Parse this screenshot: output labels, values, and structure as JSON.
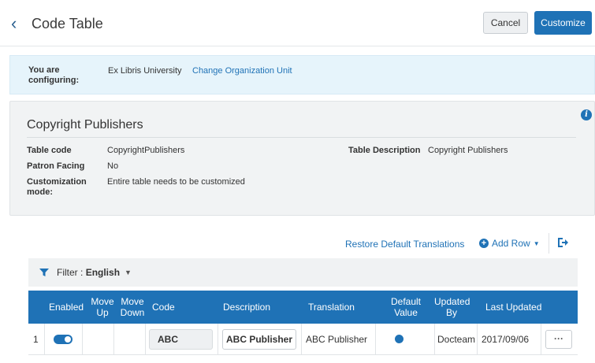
{
  "header": {
    "title": "Code Table",
    "cancel_label": "Cancel",
    "customize_label": "Customize"
  },
  "config": {
    "label": "You are configuring:",
    "org": "Ex Libris University",
    "change_link": "Change Organization Unit"
  },
  "panel": {
    "title": "Copyright Publishers",
    "table_code_label": "Table code",
    "table_code": "CopyrightPublishers",
    "patron_facing_label": "Patron Facing",
    "patron_facing": "No",
    "customization_label": "Customization mode:",
    "customization": "Entire table needs to be customized",
    "table_desc_label": "Table Description",
    "table_desc": "Copyright Publishers"
  },
  "toolbar": {
    "restore_label": "Restore Default Translations",
    "add_row_label": "Add Row"
  },
  "filter": {
    "label": "Filter :",
    "value": "English"
  },
  "table": {
    "headers": {
      "enabled": "Enabled",
      "move_up": "Move Up",
      "move_down": "Move Down",
      "code": "Code",
      "description": "Description",
      "translation": "Translation",
      "default_value": "Default Value",
      "updated_by": "Updated By",
      "last_updated": "Last Updated"
    },
    "rows": [
      {
        "index": "1",
        "enabled": true,
        "code": "ABC",
        "description": "ABC Publisher",
        "translation": "ABC Publisher",
        "default_value": true,
        "updated_by": "Docteam",
        "last_updated": "2017/09/06"
      }
    ]
  },
  "colors": {
    "accent": "#1f72b6",
    "banner_bg": "#e6f4fb",
    "panel_bg": "#f1f3f4"
  },
  "icons": {
    "back": "chevron-left-icon",
    "info": "info-icon",
    "add": "plus-circle-icon",
    "export": "export-icon",
    "filter": "funnel-icon",
    "more": "ellipsis-icon"
  }
}
